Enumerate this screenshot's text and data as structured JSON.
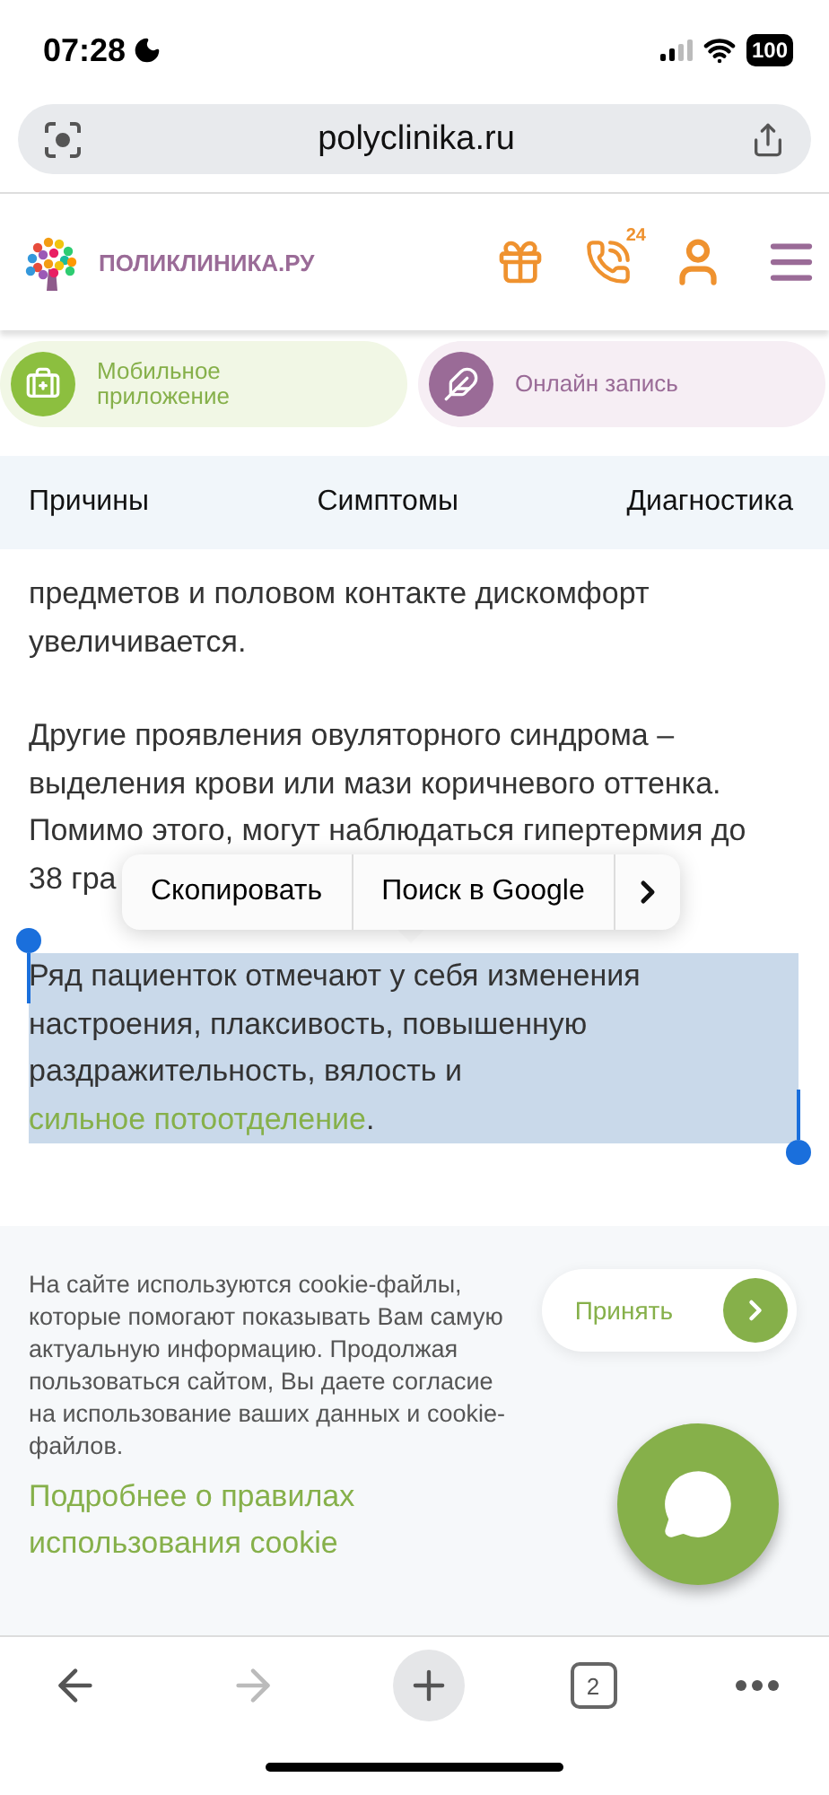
{
  "status_bar": {
    "time": "07:28",
    "battery": "100"
  },
  "address_bar": {
    "url": "polyclinika.ru"
  },
  "site_header": {
    "brand": "ПОЛИКЛИНИКА.РУ",
    "phone_badge": "24"
  },
  "promo_buttons": [
    {
      "kind": "app",
      "label": "Мобильное приложение"
    },
    {
      "kind": "booking",
      "label": "Онлайн запись"
    }
  ],
  "section_tabs": [
    "Причины",
    "Симптомы",
    "Диагностика"
  ],
  "article": [
    {
      "kind": "lines",
      "selected": false,
      "lines": [
        "предметов и половом контакте дискомфорт",
        "увеличивается."
      ]
    },
    {
      "kind": "lines",
      "selected": false,
      "lines": [
        "Другие проявления овуляторного синдрома –",
        "выделения крови или мази коричневого оттенка.",
        "Помимо этого, могут наблюдаться гипертермия до"
      ],
      "cut_line": "38 гра"
    },
    {
      "kind": "linked",
      "selected": true,
      "text": "Ряд пациенток отмечают у себя изменения настроения, плаксивость, повышенную раздражительность, вялость и ",
      "link": "сильное потоотделение",
      "after": "."
    }
  ],
  "context_menu": {
    "items": [
      "Скопировать",
      "Поиск в Google"
    ]
  },
  "cookie_notice": {
    "text": "На сайте используются cookie-файлы, которые помогают показывать Вам самую актуальную информацию. Продолжая пользоваться сайтом, Вы даете согласие на использование ваших данных и cookie-файлов.",
    "link": "Подробнее о правилах использования cookie",
    "accept": "Принять"
  },
  "browser_toolbar": {
    "forward_disabled": true,
    "tab_count": "2"
  }
}
